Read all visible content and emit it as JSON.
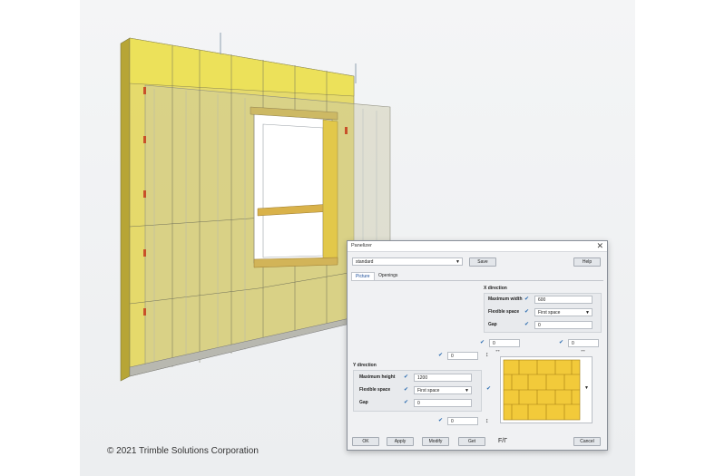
{
  "copyright": "© 2021 Trimble Solutions Corporation",
  "dialog": {
    "title": "Panelizer",
    "close_glyph": "✕",
    "preset_value": "standard",
    "save_label": "Save",
    "help_label": "Help",
    "tabs": [
      "Picture",
      "Openings"
    ],
    "active_tab": "Picture",
    "x_direction": {
      "heading": "X direction",
      "max_width_label": "Maximum width",
      "max_width_value": "600",
      "flexible_label": "Flexible space",
      "flexible_value": "First space",
      "gap_label": "Gap",
      "gap_value": "0"
    },
    "y_direction": {
      "heading": "Y direction",
      "max_height_label": "Maximum height",
      "max_height_value": "1200",
      "flexible_label": "Flexible space",
      "flexible_value": "First space",
      "gap_label": "Gap",
      "gap_value": "0"
    },
    "offset_left_value": "0",
    "offset_right_value": "0",
    "offset_top_value": "0",
    "offset_bottom_value": "0",
    "check_glyph": "✔",
    "horiz_arrow": "↔",
    "vert_arrow": "↕",
    "dropdown_glyph": "▼",
    "corner_glyph": "F/Γ",
    "ok_label": "OK",
    "apply_label": "Apply",
    "modify_label": "Modify",
    "get_label": "Get",
    "cancel_label": "Cancel"
  },
  "colors": {
    "insulation": "#e6d64a",
    "frame": "#c8a844",
    "accent": "#1a4d99"
  }
}
